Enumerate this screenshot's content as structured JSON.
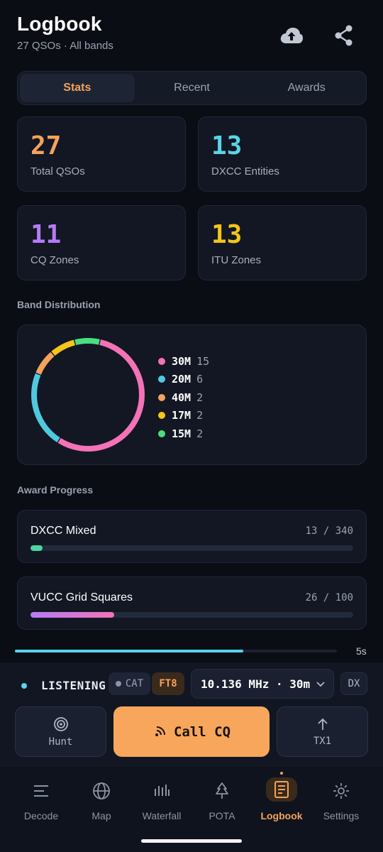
{
  "header": {
    "title": "Logbook",
    "subtitle": "27 QSOs · All bands",
    "upload_icon": "cloud-upload-icon",
    "share_icon": "share-icon"
  },
  "tabs": [
    {
      "label": "Stats",
      "active": true
    },
    {
      "label": "Recent",
      "active": false
    },
    {
      "label": "Awards",
      "active": false
    }
  ],
  "stats": [
    {
      "value": "27",
      "label": "Total QSOs",
      "color": "#f4a35c"
    },
    {
      "value": "13",
      "label": "DXCC Entities",
      "color": "#59d4e6"
    },
    {
      "value": "11",
      "label": "CQ Zones",
      "color": "#b57cf5"
    },
    {
      "value": "13",
      "label": "ITU Zones",
      "color": "#f5c518"
    }
  ],
  "band_distribution": {
    "title": "Band Distribution",
    "bands": [
      {
        "band": "30M",
        "count": "15",
        "color": "#f472b6"
      },
      {
        "band": "20M",
        "count": "6",
        "color": "#4fc9e0"
      },
      {
        "band": "40M",
        "count": "2",
        "color": "#f4a35c"
      },
      {
        "band": "17M",
        "count": "2",
        "color": "#f5c518"
      },
      {
        "band": "15M",
        "count": "2",
        "color": "#4ade80"
      }
    ]
  },
  "awards": {
    "title": "Award Progress",
    "items": [
      {
        "name": "DXCC Mixed",
        "count": "13 / 340",
        "progress": 0.038
      },
      {
        "name": "VUCC Grid Squares",
        "count": "26 / 100",
        "progress": 0.26
      }
    ]
  },
  "cycle": {
    "label": "5s",
    "progress": 0.71
  },
  "status": {
    "listening": "LISTENING",
    "cat": "CAT",
    "mode": "FT8",
    "frequency": "10.136 MHz · 30m",
    "dx": "DX"
  },
  "controls": {
    "hunt": "Hunt",
    "call": "Call CQ",
    "tx": "TX1"
  },
  "nav": [
    {
      "label": "Decode",
      "icon": "decode-list-icon"
    },
    {
      "label": "Map",
      "icon": "globe-icon"
    },
    {
      "label": "Waterfall",
      "icon": "waterfall-icon"
    },
    {
      "label": "POTA",
      "icon": "tree-icon"
    },
    {
      "label": "Logbook",
      "icon": "logbook-icon",
      "active": true
    },
    {
      "label": "Settings",
      "icon": "gear-icon"
    }
  ]
}
